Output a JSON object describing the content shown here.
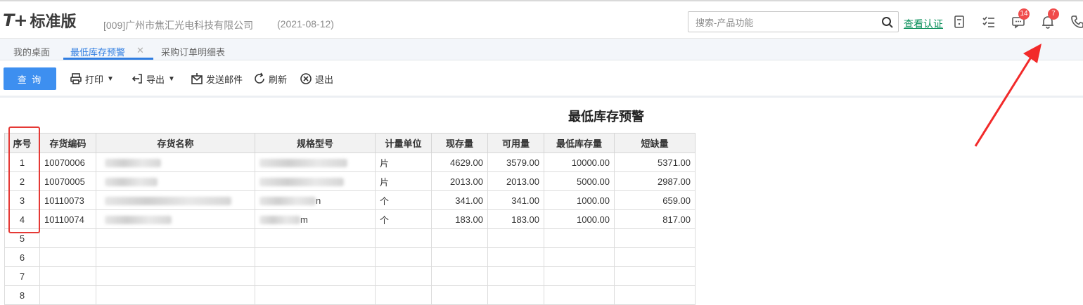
{
  "header": {
    "logo_mark": "T+",
    "logo_text": "标准版",
    "company": "[009]广州市焦汇光电科技有限公司",
    "date": "(2021-08-12)",
    "search_placeholder": "搜索-产品功能",
    "verify_link": "查看认证",
    "message_badge": "14",
    "notification_badge": "7",
    "accent_color": "#2f7de1",
    "badge_color": "#f04b4b"
  },
  "tabs": [
    {
      "label": "我的桌面",
      "active": false
    },
    {
      "label": "最低库存预警",
      "active": true
    },
    {
      "label": "采购订单明细表",
      "active": false
    }
  ],
  "toolbar": {
    "query_label": "查 询",
    "print_label": "打印",
    "export_label": "导出",
    "email_label": "发送邮件",
    "refresh_label": "刷新",
    "exit_label": "退出"
  },
  "report": {
    "title": "最低库存预警",
    "columns": [
      "序号",
      "存货编码",
      "存货名称",
      "规格型号",
      "计量单位",
      "现存量",
      "可用量",
      "最低库存量",
      "短缺量"
    ],
    "rows": [
      {
        "seq": "1",
        "code": "10070006",
        "name": "",
        "spec": "",
        "unit": "片",
        "stock": "4629.00",
        "available": "3579.00",
        "min_stock": "10000.00",
        "shortage": "5371.00"
      },
      {
        "seq": "2",
        "code": "10070005",
        "name": "",
        "spec": "",
        "unit": "片",
        "stock": "2013.00",
        "available": "2013.00",
        "min_stock": "5000.00",
        "shortage": "2987.00"
      },
      {
        "seq": "3",
        "code": "10110073",
        "name": "",
        "spec": "n",
        "unit": "个",
        "stock": "341.00",
        "available": "341.00",
        "min_stock": "1000.00",
        "shortage": "659.00"
      },
      {
        "seq": "4",
        "code": "10110074",
        "name": "",
        "spec": "m",
        "unit": "个",
        "stock": "183.00",
        "available": "183.00",
        "min_stock": "1000.00",
        "shortage": "817.00"
      },
      {
        "seq": "5",
        "code": "",
        "name": "",
        "spec": "",
        "unit": "",
        "stock": "",
        "available": "",
        "min_stock": "",
        "shortage": ""
      },
      {
        "seq": "6",
        "code": "",
        "name": "",
        "spec": "",
        "unit": "",
        "stock": "",
        "available": "",
        "min_stock": "",
        "shortage": ""
      },
      {
        "seq": "7",
        "code": "",
        "name": "",
        "spec": "",
        "unit": "",
        "stock": "",
        "available": "",
        "min_stock": "",
        "shortage": ""
      },
      {
        "seq": "8",
        "code": "",
        "name": "",
        "spec": "",
        "unit": "",
        "stock": "",
        "available": "",
        "min_stock": "",
        "shortage": ""
      }
    ]
  },
  "annotations": {
    "highlight_color": "#e53935",
    "arrow_color": "#f22a2a"
  }
}
